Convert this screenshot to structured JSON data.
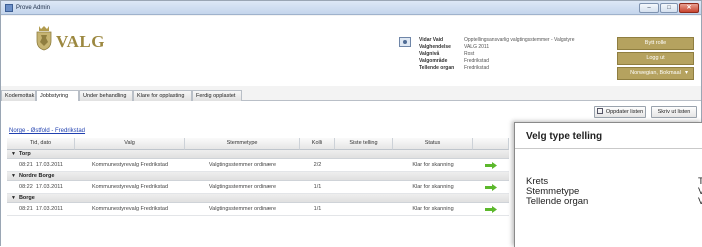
{
  "window": {
    "title": "Prove Admin",
    "minimize_glyph": "–",
    "maximize_glyph": "□",
    "close_glyph": "✕"
  },
  "header": {
    "logo_text": "VALG",
    "user": {
      "fields": [
        {
          "label": "Vidar Vaid",
          "value": "Opptellingsansvarlig valgtingsstemmer - Valgstyre"
        },
        {
          "label": "Valghendelse",
          "value": "VALG 2011"
        },
        {
          "label": "Valgnivå",
          "value": "Rost"
        },
        {
          "label": "Valgområde",
          "value": "Fredrikstad"
        },
        {
          "label": "Tellende organ",
          "value": "Fredrikstad"
        }
      ]
    },
    "buttons": {
      "switch_role": "Bytt rolle",
      "logout": "Logg ut",
      "location": "Norwegian, Bokmaal"
    },
    "accent_color": "#b5a25f"
  },
  "tabs": [
    {
      "label": "Kodemottak",
      "active": false
    },
    {
      "label": "Jobbstyring",
      "active": true
    },
    {
      "label": "Under behandling",
      "active": false
    },
    {
      "label": "Klare for opplasting",
      "active": false
    },
    {
      "label": "Ferdig opplastet",
      "active": false
    }
  ],
  "toolbar": {
    "refresh_label": "Oppdater listen",
    "print_label": "Skriv ut listen"
  },
  "breadcrumb": "Norge - Østfold - Fredrikstad",
  "table": {
    "columns": [
      "Tid, dato",
      "Valg",
      "Stemmetype",
      "Kolli",
      "Siste telling",
      "Status"
    ],
    "groups": [
      {
        "name": "Torp",
        "rows": [
          {
            "time": "08:21",
            "date": "17.03.2011",
            "valg": "Kommunestyrevalg Fredrikstad",
            "stemmetype": "Valgtingsstemmer ordinære",
            "kolli": "2/2",
            "siste_telling": "",
            "status": "Klar for skanning"
          }
        ]
      },
      {
        "name": "Nordre Borge",
        "rows": [
          {
            "time": "08:22",
            "date": "17.03.2011",
            "valg": "Kommunestyrevalg Fredrikstad",
            "stemmetype": "Valgtingsstemmer ordinære",
            "kolli": "1/1",
            "siste_telling": "",
            "status": "Klar for skanning"
          }
        ]
      },
      {
        "name": "Borge",
        "rows": [
          {
            "time": "08:21",
            "date": "17.03.2011",
            "valg": "Kommunestyrevalg Fredrikstad",
            "stemmetype": "Valgtingsstemmer ordinære",
            "kolli": "1/1",
            "siste_telling": "",
            "status": "Klar for skanning"
          }
        ]
      }
    ],
    "action_icon": "green-right-arrow-icon"
  },
  "popup": {
    "title": "Velg type telling",
    "fields": [
      {
        "label": "Krets",
        "value": "T"
      },
      {
        "label": "Stemmetype",
        "value": "V"
      },
      {
        "label": "Tellende organ",
        "value": "V"
      }
    ]
  }
}
